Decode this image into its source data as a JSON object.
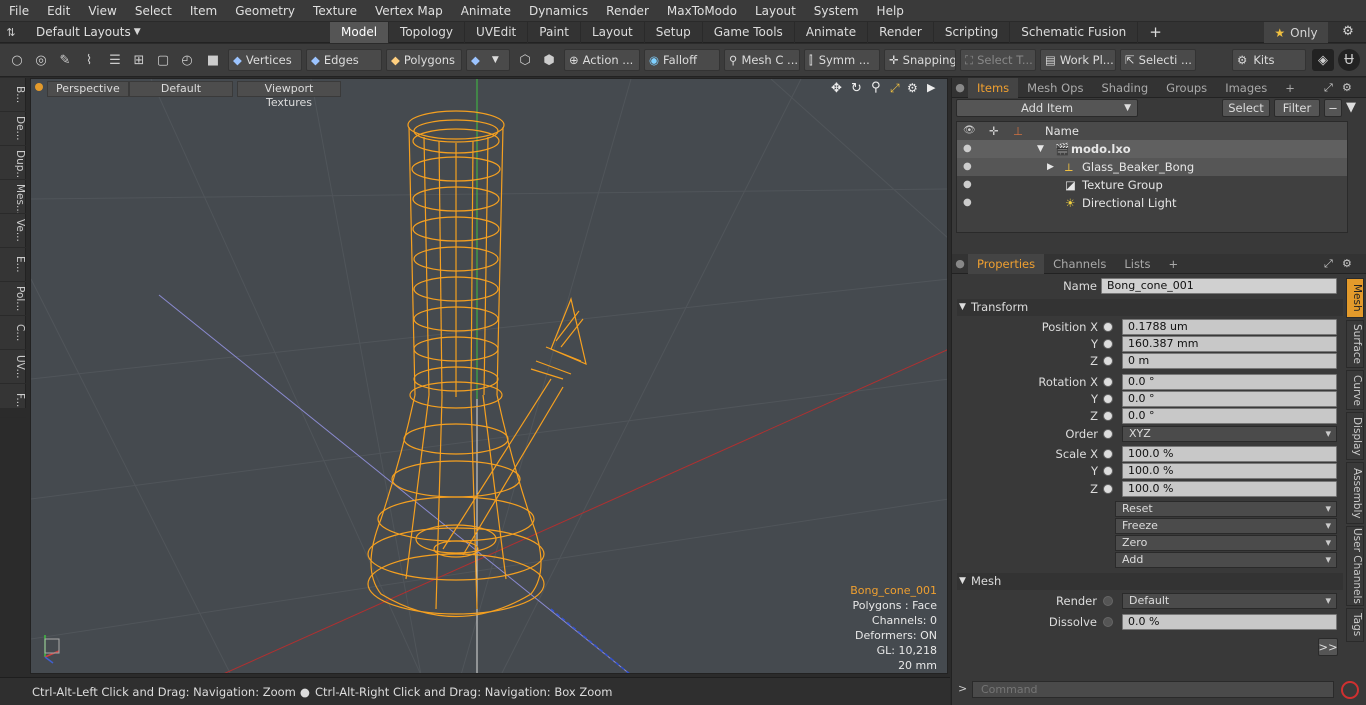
{
  "menu": [
    "File",
    "Edit",
    "View",
    "Select",
    "Item",
    "Geometry",
    "Texture",
    "Vertex Map",
    "Animate",
    "Dynamics",
    "Render",
    "MaxToModo",
    "Layout",
    "System",
    "Help"
  ],
  "layouts": {
    "label": "Default Layouts"
  },
  "tabs": [
    {
      "label": "Model",
      "active": true
    },
    {
      "label": "Topology"
    },
    {
      "label": "UVEdit"
    },
    {
      "label": "Paint"
    },
    {
      "label": "Layout"
    },
    {
      "label": "Setup"
    },
    {
      "label": "Game Tools"
    },
    {
      "label": "Animate"
    },
    {
      "label": "Render"
    },
    {
      "label": "Scripting"
    },
    {
      "label": "Schematic Fusion"
    }
  ],
  "only_label": "Only",
  "toolbar": {
    "vertices": "Vertices",
    "edges": "Edges",
    "polygons": "Polygons",
    "action": "Action ...",
    "falloff": "Falloff",
    "mesh_c": "Mesh C ...",
    "symm": "Symm ...",
    "snapping": "Snapping",
    "select_t": "Select T...",
    "work_pl": "Work Pl...",
    "selecti": "Selecti ...",
    "kits": "Kits"
  },
  "left_tabs": [
    "B...",
    "De...",
    "Dup...",
    "Mes...",
    "Ve...",
    "E...",
    "Pol...",
    "C...",
    "UV...",
    "F..."
  ],
  "viewport": {
    "perspective": "Perspective",
    "default": "Default",
    "textures": "Viewport Textures",
    "info": {
      "name": "Bong_cone_001",
      "polygons": "Polygons : Face",
      "channels": "Channels: 0",
      "deformers": "Deformers: ON",
      "gl": "GL: 10,218",
      "scale": "20 mm"
    }
  },
  "status": {
    "left": "Ctrl-Alt-Left Click and Drag: Navigation: Zoom",
    "right": "Ctrl-Alt-Right Click and Drag: Navigation: Box Zoom"
  },
  "items_tabs": [
    "Items",
    "Mesh Ops",
    "Shading",
    "Groups",
    "Images"
  ],
  "items_toolbar": {
    "add_item": "Add Item",
    "select": "Select",
    "filter": "Filter"
  },
  "items_header": "Name",
  "items": [
    "modo.lxo",
    "Glass_Beaker_Bong",
    "Texture Group",
    "Directional Light"
  ],
  "props_tabs": [
    "Properties",
    "Channels",
    "Lists"
  ],
  "props": {
    "name_label": "Name",
    "name_value": "Bong_cone_001",
    "transform": "Transform",
    "pos": [
      {
        "l": "Position X",
        "v": "0.1788 um"
      },
      {
        "l": "Y",
        "v": "160.387 mm"
      },
      {
        "l": "Z",
        "v": "0 m"
      }
    ],
    "rot": [
      {
        "l": "Rotation X",
        "v": "0.0 °"
      },
      {
        "l": "Y",
        "v": "0.0 °"
      },
      {
        "l": "Z",
        "v": "0.0 °"
      }
    ],
    "order_label": "Order",
    "order_value": "XYZ",
    "scale": [
      {
        "l": "Scale X",
        "v": "100.0 %"
      },
      {
        "l": "Y",
        "v": "100.0 %"
      },
      {
        "l": "Z",
        "v": "100.0 %"
      }
    ],
    "actions": [
      "Reset",
      "Freeze",
      "Zero",
      "Add"
    ],
    "mesh": "Mesh",
    "render_label": "Render",
    "render_value": "Default",
    "dissolve_label": "Dissolve",
    "dissolve_value": "0.0 %",
    "more": ">>"
  },
  "side_tabs": [
    "Mesh",
    "Surface",
    "Curve",
    "Display",
    "Assembly",
    "User Channels",
    "Tags"
  ],
  "command_placeholder": "Command"
}
